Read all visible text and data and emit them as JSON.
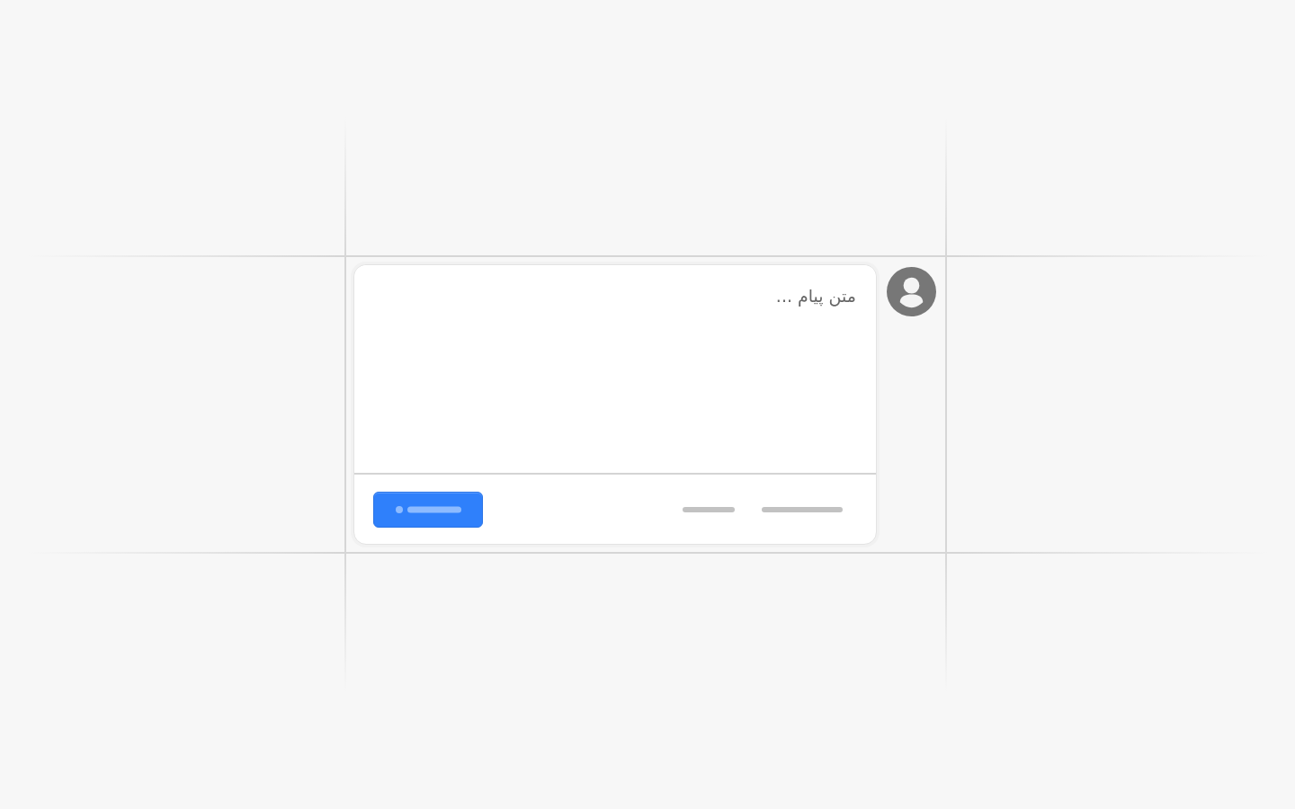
{
  "composer": {
    "placeholder": "متن پیام ..."
  }
}
